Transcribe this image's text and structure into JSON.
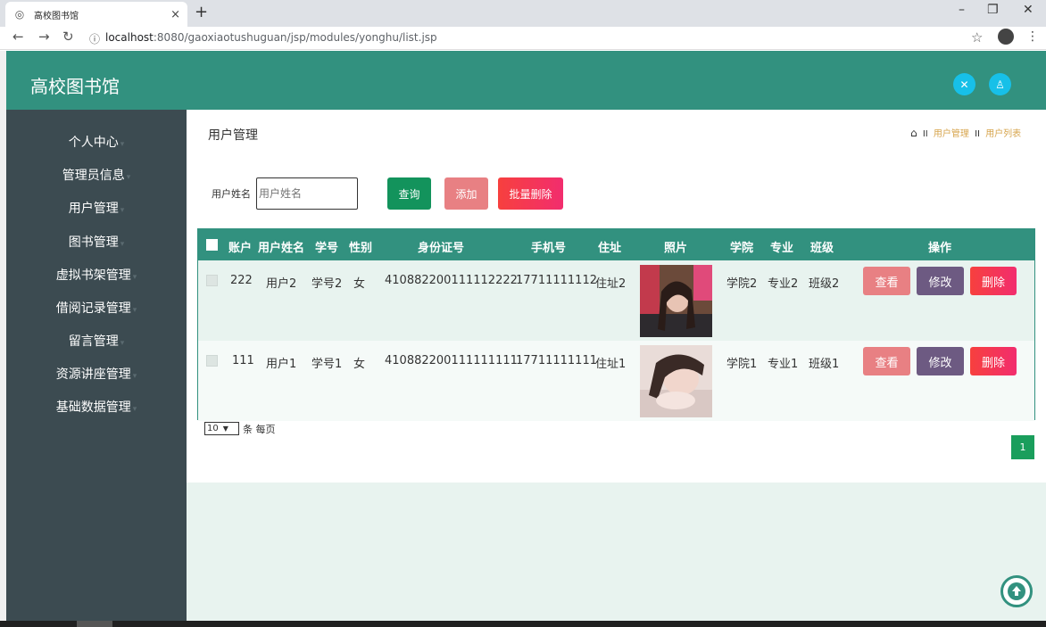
{
  "browser": {
    "tab_title": "高校图书馆",
    "tab_close": "×",
    "new_tab": "+",
    "url_host": "localhost",
    "url_path": ":8080/gaoxiaotushuguan/jsp/modules/yonghu/list.jsp"
  },
  "app": {
    "title": "高校图书馆"
  },
  "sidebar": {
    "items": [
      {
        "label": "个人中心"
      },
      {
        "label": "管理员信息"
      },
      {
        "label": "用户管理"
      },
      {
        "label": "图书管理"
      },
      {
        "label": "虚拟书架管理"
      },
      {
        "label": "借阅记录管理"
      },
      {
        "label": "留言管理"
      },
      {
        "label": "资源讲座管理"
      },
      {
        "label": "基础数据管理"
      }
    ]
  },
  "page": {
    "title": "用户管理",
    "breadcrumb": [
      "用户管理",
      "用户列表"
    ],
    "breadcrumb_sep": "II"
  },
  "search": {
    "label": "用户姓名",
    "placeholder": "用户姓名",
    "query_label": "查询",
    "add_label": "添加",
    "batch_delete_label": "批量删除"
  },
  "table": {
    "headers": [
      "账户",
      "用户姓名",
      "学号",
      "性别",
      "身份证号",
      "手机号",
      "住址",
      "照片",
      "学院",
      "专业",
      "班级",
      "操作"
    ],
    "rows": [
      {
        "account": "222",
        "name": "用户2",
        "student_no": "学号2",
        "gender": "女",
        "id_card": "410882200111112222",
        "phone": "17711111112",
        "address": "住址2",
        "college": "学院2",
        "major": "专业2",
        "class": "班级2"
      },
      {
        "account": "111",
        "name": "用户1",
        "student_no": "学号1",
        "gender": "女",
        "id_card": "410882200111111111",
        "phone": "17711111111",
        "address": "住址1",
        "college": "学院1",
        "major": "专业1",
        "class": "班级1"
      }
    ],
    "actions": {
      "view": "查看",
      "edit": "修改",
      "delete": "删除"
    }
  },
  "pager": {
    "page_size": "10",
    "per_page_label": "条 每页",
    "current_page": "1"
  },
  "colors": {
    "primary": "#32917f",
    "sidebar": "#3c4b51",
    "view": "#e88083",
    "edit": "#6d5a82",
    "delete": "#f7403e",
    "query": "#13935c",
    "add": "#e88083",
    "batch_delete": "#f7403e"
  }
}
